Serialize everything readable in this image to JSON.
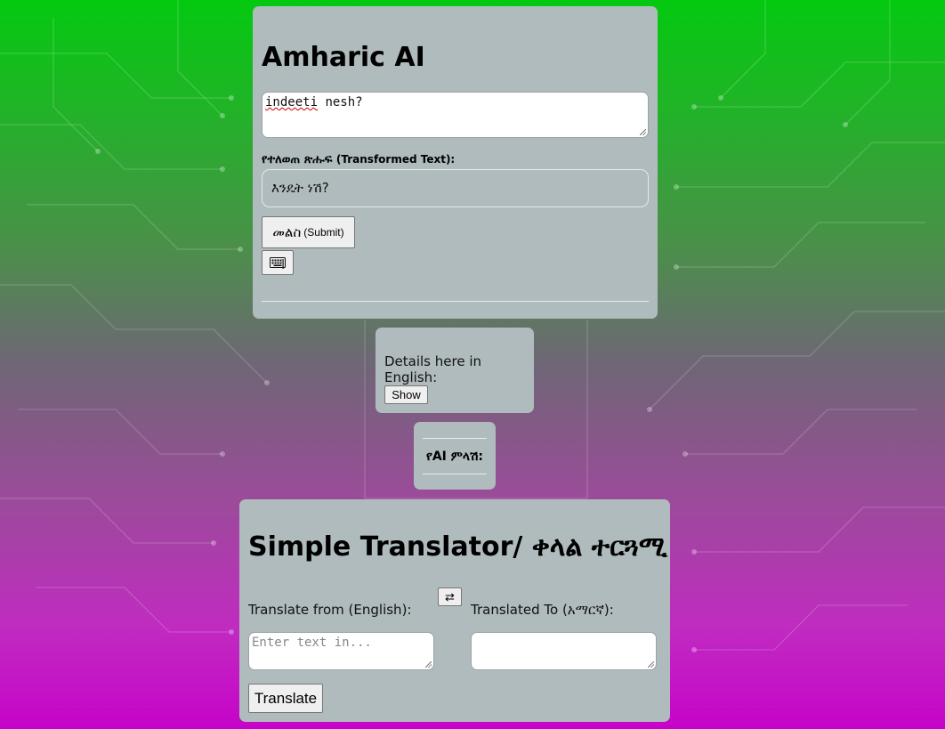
{
  "amharic_ai": {
    "title": "Amharic AI",
    "input_value": "indeeti nesh?",
    "transformed_label": "የተለወጠ ጽሑፍ",
    "transformed_label_en": "(Transformed Text):",
    "transformed_value": "እንዴት ነሽ?",
    "submit_label": "መልስ",
    "submit_label_en": "(Submit)",
    "keyboard_icon": "keyboard-icon"
  },
  "details": {
    "text": "Details here in English:",
    "show_label": "Show"
  },
  "ai_response": {
    "label": "የAI ምላሽ:"
  },
  "translator": {
    "title": "Simple Translator/ ቀላል ተርጓሚ",
    "from_label": "Translate from (English):",
    "to_label": "Translated To (አማርኛ):",
    "swap_label": "⇄",
    "from_placeholder": "Enter text in...",
    "to_value": "",
    "translate_label": "Translate"
  },
  "colors": {
    "background_top": "#04c910",
    "background_bottom": "#c603c9",
    "card": "#b0bbbd"
  }
}
